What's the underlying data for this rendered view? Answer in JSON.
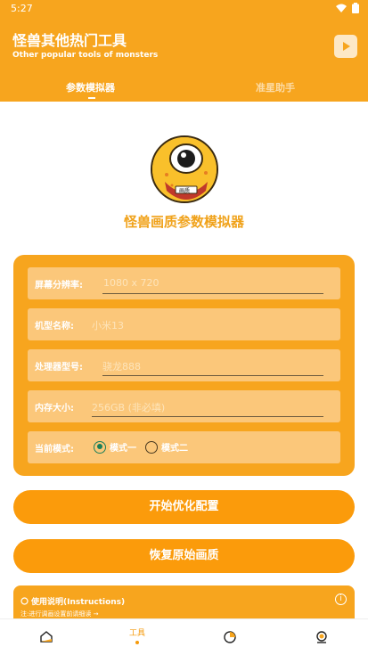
{
  "status_bar": {
    "time": "5:27"
  },
  "header": {
    "title": "怪兽其他热门工具",
    "subtitle": "Other popular tools of monsters",
    "play_icon": "play-icon"
  },
  "tabs": [
    {
      "label": "参数模拟器",
      "active": true
    },
    {
      "label": "准星助手",
      "active": false
    }
  ],
  "logo": {
    "badge_text": "画质"
  },
  "app_title": "怪兽画质参数模拟器",
  "form": {
    "screen_resolution": {
      "label": "屏幕分辨率:",
      "placeholder": "1080 x 720"
    },
    "model_name": {
      "label": "机型名称:",
      "placeholder": "小米13"
    },
    "processor": {
      "label": "处理器型号:",
      "placeholder": "骁龙888"
    },
    "memory": {
      "label": "内存大小:",
      "placeholder": "256GB (非必填)"
    },
    "mode": {
      "label": "当前模式:",
      "options": [
        "模式一",
        "模式二"
      ],
      "selected": "模式一"
    }
  },
  "buttons": {
    "start": "开始优化配置",
    "restore": "恢复原始画质"
  },
  "instructions": {
    "title": "使用说明(Instructions)",
    "note": "注:进行调画设置前请细读 →",
    "info_icon": "i"
  },
  "bottom_nav": {
    "tools_label": "工具"
  },
  "colors": {
    "primary": "#f7a51e",
    "button": "#fb9b0b",
    "title_text": "#f0a21a",
    "radio_checked": "#1a7f5a"
  }
}
